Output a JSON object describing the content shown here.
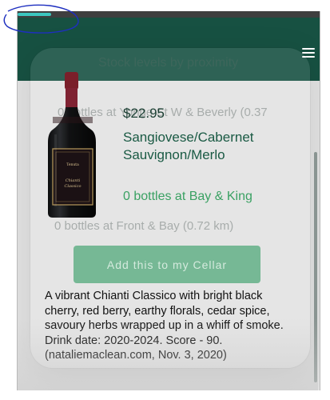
{
  "status": {
    "progress_fraction": 0.11
  },
  "header": {
    "menu_icon": "hamburger-menu-icon"
  },
  "background_list": {
    "title": "Stock levels by proximity",
    "rows": [
      "0 bottles at Yonge St W & Beverly (0.37",
      "0 bottles at Front & Bay (0.72 km)"
    ]
  },
  "product": {
    "price": "$22.95",
    "name": "Sangiovese/Cabernet Sauvignon/Merlo",
    "stock": "0 bottles at Bay & King",
    "add_button_label": "Add this to my Cellar",
    "description": "A vibrant Chianti Classico with bright black cherry, red berry, earthy florals, cedar spice, savoury herbs wrapped up in a whiff of smoke. Drink date: 2020-2024. Score - 90. (nataliemaclean.com, Nov. 3, 2020)"
  },
  "colors": {
    "header": "#175142",
    "button": "#76b895",
    "stock_text": "#3aa163",
    "name_text": "#1a5a44",
    "annotation_ink": "#1e2fc0"
  }
}
